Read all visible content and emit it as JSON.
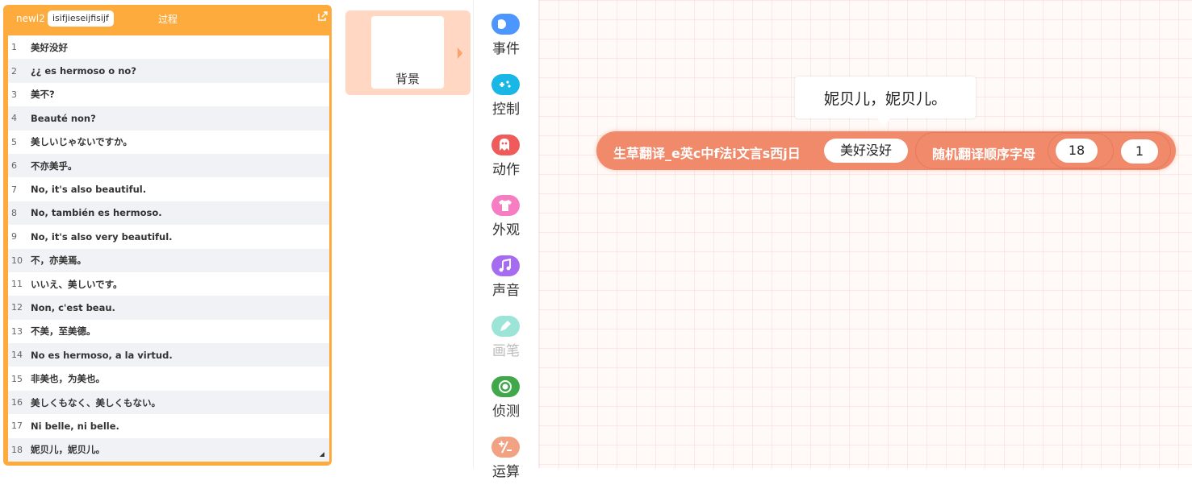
{
  "list_monitor": {
    "name": "newl2",
    "title": "isifjieseijfisijf",
    "process_label": "过程",
    "rows": [
      {
        "index": "1",
        "text": "美好没好"
      },
      {
        "index": "2",
        "text": "¿¿ es hermoso o no?"
      },
      {
        "index": "3",
        "text": "美不?"
      },
      {
        "index": "4",
        "text": "Beauté non?"
      },
      {
        "index": "5",
        "text": "美しいじゃないですか。"
      },
      {
        "index": "6",
        "text": "不亦美乎。"
      },
      {
        "index": "7",
        "text": "No, it's also beautiful."
      },
      {
        "index": "8",
        "text": "No, también es hermoso."
      },
      {
        "index": "9",
        "text": "No, it's also very beautiful."
      },
      {
        "index": "10",
        "text": "不，亦美焉。"
      },
      {
        "index": "11",
        "text": "いいえ、美しいです。"
      },
      {
        "index": "12",
        "text": "Non, c'est beau."
      },
      {
        "index": "13",
        "text": "不美，至美德。"
      },
      {
        "index": "14",
        "text": "No es hermoso, a la virtud."
      },
      {
        "index": "15",
        "text": "非美也，为美也。"
      },
      {
        "index": "16",
        "text": "美しくもなく、美しくもない。"
      },
      {
        "index": "17",
        "text": "Ni belle, ni belle."
      },
      {
        "index": "18",
        "text": "妮贝儿，妮贝儿。"
      }
    ]
  },
  "stage": {
    "label": "背景"
  },
  "categories": [
    {
      "label": "事件",
      "icon": "event-toggle-icon",
      "color": "#4c97ff"
    },
    {
      "label": "控制",
      "icon": "gamepad-icon",
      "color": "#19b7e6"
    },
    {
      "label": "动作",
      "icon": "ghost-icon",
      "color": "#ef5a5a"
    },
    {
      "label": "外观",
      "icon": "shirt-icon",
      "color": "#f77dc3"
    },
    {
      "label": "声音",
      "icon": "music-note-icon",
      "color": "#a66cf0"
    },
    {
      "label": "画笔",
      "icon": "pen-icon",
      "color": "#9de4d8"
    },
    {
      "label": "侦测",
      "icon": "target-icon",
      "color": "#3fa84a"
    },
    {
      "label": "运算",
      "icon": "operators-icon",
      "color": "#f0a283"
    }
  ],
  "workspace": {
    "bubble_text": "妮贝儿，妮贝儿。",
    "block": {
      "label": "生草翻译_e英c中f法i文言s西j日",
      "input_text": "美好没好",
      "inner_label": "随机翻译顺序字母",
      "inner_number": "18",
      "last_number": "1",
      "color": "#f18a6b"
    }
  },
  "colors": {
    "list_accent": "#fdab3d",
    "stage_card": "#ffd7c2"
  }
}
